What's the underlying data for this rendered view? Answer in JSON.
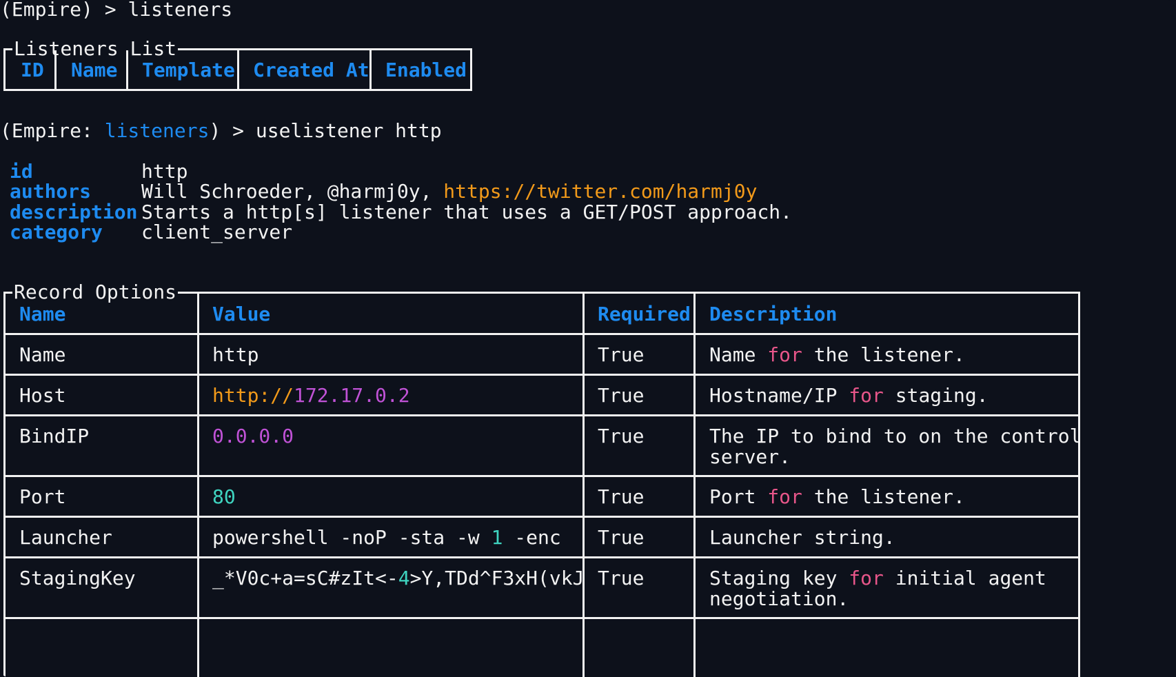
{
  "prompt1": {
    "prefix": "(Empire) > ",
    "command": "listeners"
  },
  "listeners_list": {
    "title": "Listeners List",
    "columns": [
      "ID",
      "Name",
      "Template",
      "Created At",
      "Enabled"
    ]
  },
  "prompt2": {
    "open": "(Empire: ",
    "context": "listeners",
    "close": ") > ",
    "command": "uselistener http"
  },
  "info": {
    "id_label": "id",
    "id_value": "http",
    "authors_label": "authors",
    "authors_value": "Will Schroeder, @harmj0y, ",
    "authors_link": "https://twitter.com/harmj0y",
    "description_label": "description",
    "description_value": "Starts a http[s] listener that uses a GET/POST approach.",
    "category_label": "category",
    "category_value": "client_server"
  },
  "record_options": {
    "title": "Record Options",
    "columns": [
      "Name",
      "Value",
      "Required",
      "Description"
    ],
    "rows": [
      {
        "name": "Name",
        "value": "http",
        "required": "True",
        "desc_a": "Name ",
        "desc_kw": "for",
        "desc_b": " the listener."
      },
      {
        "name": "Host",
        "value_scheme": "http://",
        "value_ip": "172.17.0.2",
        "required": "True",
        "desc_a": "Hostname/IP ",
        "desc_kw": "for",
        "desc_b": " staging."
      },
      {
        "name": "BindIP",
        "value": "0.0.0.0",
        "required": "True",
        "desc_line1": "The IP to bind to on the control",
        "desc_line2": "server."
      },
      {
        "name": "Port",
        "value": "80",
        "required": "True",
        "desc_a": "Port ",
        "desc_kw": "for",
        "desc_b": " the listener."
      },
      {
        "name": "Launcher",
        "value_a": "powershell -noP -sta -w ",
        "value_num": "1",
        "value_b": " -enc",
        "required": "True",
        "desc": "Launcher string."
      },
      {
        "name": "StagingKey",
        "value_a": "_*V0c+a=sC#zIt<-",
        "value_num": "4",
        "value_b": ">Y,TDd^F3xH(vkJ",
        "required": "True",
        "desc_a": "Staging key ",
        "desc_kw": "for",
        "desc_b": " initial agent",
        "desc_line2": "negotiation."
      }
    ]
  },
  "colors": {
    "background": "#0d111b",
    "text": "#f2f2f2",
    "accent_blue": "#1e8bf0",
    "url_orange": "#f29a1a",
    "number_purple": "#c052d6",
    "number_teal": "#3fd4c0",
    "keyword_pink": "#e8568a"
  }
}
